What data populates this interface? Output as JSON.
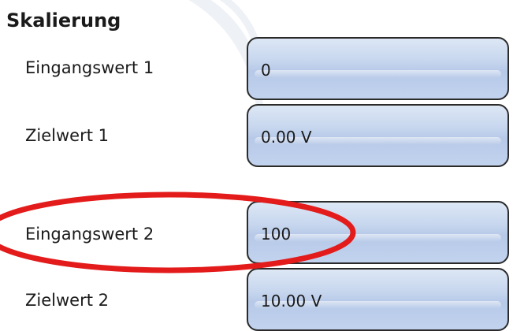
{
  "section": {
    "title": "Skalierung"
  },
  "rows": [
    {
      "label": "Eingangswert 1",
      "value": "0"
    },
    {
      "label": "Zielwert 1",
      "value": "0.00 V"
    },
    {
      "label": "Eingangswert 2",
      "value": "100"
    },
    {
      "label": "Zielwert 2",
      "value": "10.00 V"
    }
  ],
  "highlight": {
    "color": "#e31b1b",
    "target_row": "Eingangswert 2"
  }
}
